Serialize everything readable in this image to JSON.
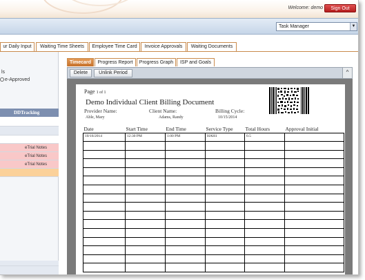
{
  "header": {
    "welcome": "Welcome: demo",
    "sign_out": "Sign Out",
    "task_select": "Task Manager"
  },
  "top_tabs": [
    {
      "label": "ur Daily Input"
    },
    {
      "label": "Waiting Time Sheets"
    },
    {
      "label": "Employee Time Card"
    },
    {
      "label": "Invoice Approvals"
    },
    {
      "label": "Waiting Documents"
    }
  ],
  "left_panel": {
    "label1": "ls",
    "label2": "e-Approved",
    "grid_header": "DDTracking",
    "notes": [
      "eTrial Notes",
      "eTrial Notes",
      "eTrial Notes"
    ]
  },
  "timecard_tabs": [
    {
      "label": "Timecard",
      "active": true
    },
    {
      "label": "Progress Report"
    },
    {
      "label": "Progress Graph"
    },
    {
      "label": "ISP and Goals"
    }
  ],
  "toolbar": {
    "delete": "Delete",
    "unlink": "Unlink Period"
  },
  "document": {
    "page_label": "Page",
    "page_of": "1 of 1",
    "title": "Demo Individual Client Billing Document",
    "provider_label": "Provider Name:",
    "provider_value": "Able, Mary",
    "client_label": "Client Name:",
    "client_value": "Adams, Randy",
    "cycle_label": "Billing Cycle:",
    "cycle_value": "10/15/2014",
    "columns": [
      "Date",
      "Start Time",
      "End Time",
      "Service Type",
      "Total Hours",
      "Approval Initial"
    ],
    "rows": [
      [
        "10/16/2014",
        "12:30 PM",
        "1:00 PM",
        "HAH1",
        "0.5",
        ""
      ]
    ],
    "empty_rows": 15
  }
}
